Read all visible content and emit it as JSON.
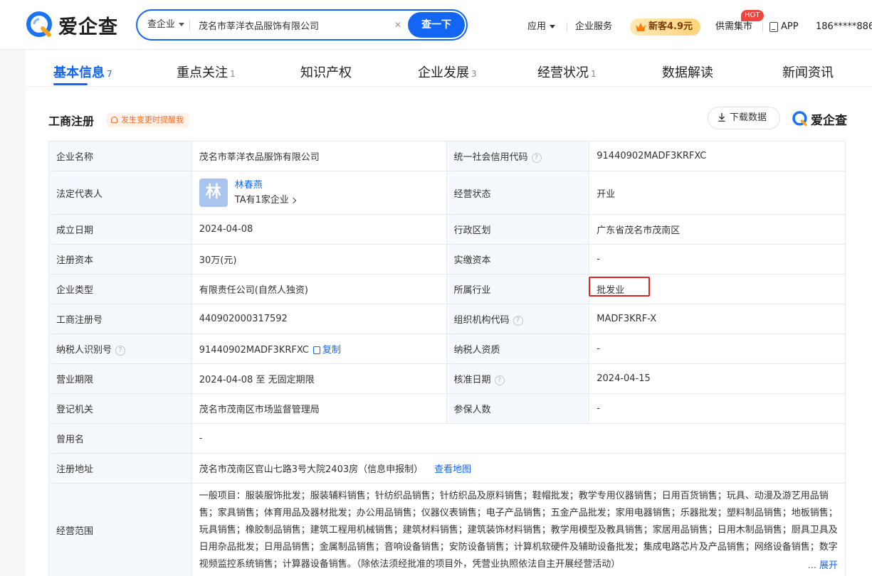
{
  "header": {
    "logo_text": "爱企查",
    "search": {
      "type_label": "查企业",
      "query": "茂名市莘洋衣品服饰有限公司",
      "clear_icon": "close-icon",
      "button_label": "查一下"
    },
    "nav": {
      "apps": "应用",
      "enterprise_service": "企业服务",
      "promo": "新客4.9元",
      "supply_demand": "供需集市",
      "hot_badge": "HOT",
      "app": "APP",
      "user": "186*****886"
    },
    "colors": {
      "brand": "#1365f3",
      "promo_text": "#7a3d00",
      "hot": "#f0443f"
    }
  },
  "tabs": [
    {
      "label": "基本信息",
      "count": "7",
      "active": true
    },
    {
      "label": "重点关注",
      "count": "1"
    },
    {
      "label": "知识产权",
      "count": ""
    },
    {
      "label": "企业发展",
      "count": "3"
    },
    {
      "label": "经营状况",
      "count": "1"
    },
    {
      "label": "数据解读",
      "count": ""
    },
    {
      "label": "新闻资讯",
      "count": ""
    }
  ],
  "section": {
    "title": "工商注册",
    "remind": "发生变更时提醒我",
    "download": "下载数据",
    "logo_text": "爱企查"
  },
  "registration": {
    "company_name_label": "企业名称",
    "company_name": "茂名市莘洋衣品服饰有限公司",
    "credit_code_label": "统一社会信用代码",
    "credit_code": "91440902MADF3KRFXC",
    "legal_rep_label": "法定代表人",
    "legal_rep_avatar": "林",
    "legal_rep_name": "林春燕",
    "legal_rep_sub": "TA有1家企业",
    "status_label": "经营状态",
    "status": "开业",
    "founded_label": "成立日期",
    "founded": "2024-04-08",
    "region_label": "行政区划",
    "region": "广东省茂名市茂南区",
    "capital_label": "注册资本",
    "capital": "30万(元)",
    "paid_capital_label": "实缴资本",
    "paid_capital": "-",
    "type_label": "企业类型",
    "type": "有限责任公司(自然人独资)",
    "industry_label": "所属行业",
    "industry": "批发业",
    "reg_no_label": "工商注册号",
    "reg_no": "440902000317592",
    "org_code_label": "组织机构代码",
    "org_code": "MADF3KRF-X",
    "taxpayer_id_label": "纳税人识别号",
    "taxpayer_id": "91440902MADF3KRFXC",
    "copy_label": "复制",
    "taxpayer_qual_label": "纳税人资质",
    "taxpayer_qual": "-",
    "term_label": "营业期限",
    "term": "2024-04-08 至 无固定期限",
    "approval_date_label": "核准日期",
    "approval_date": "2024-04-15",
    "authority_label": "登记机关",
    "authority": "茂名市茂南区市场监督管理局",
    "insured_label": "参保人数",
    "insured": "-",
    "former_name_label": "曾用名",
    "former_name": "-",
    "address_label": "注册地址",
    "address": "茂名市茂南区官山七路3号大院2403房（信息申报制）",
    "map_link": "查看地图",
    "scope_label": "经营范围",
    "scope": "一般项目：服装服饰批发；服装辅料销售；针纺织品销售；针纺织品及原料销售；鞋帽批发；教学专用仪器销售；日用百货销售；玩具、动漫及游艺用品销售；家具销售；体育用品及器材批发；办公用品销售；仪器仪表销售；电子产品销售；五金产品批发；家用电器销售；乐器批发；塑料制品销售；地板销售；玩具销售；橡胶制品销售；建筑工程用机械销售；建筑材料销售；建筑装饰材料销售；教学用模型及教具销售；家居用品销售；日用木制品销售；厨具卫具及日用杂品批发；日用品销售；金属制品销售；音响设备销售；安防设备销售；计算机软硬件及辅助设备批发；集成电路芯片及产品销售；网络设备销售；数字视频监控系统销售；计算器设备销售。（除依法须经批准的项目外，凭营业执照依法自主开展经营活动）",
    "expand_dots": "...",
    "expand_label": "展开"
  }
}
